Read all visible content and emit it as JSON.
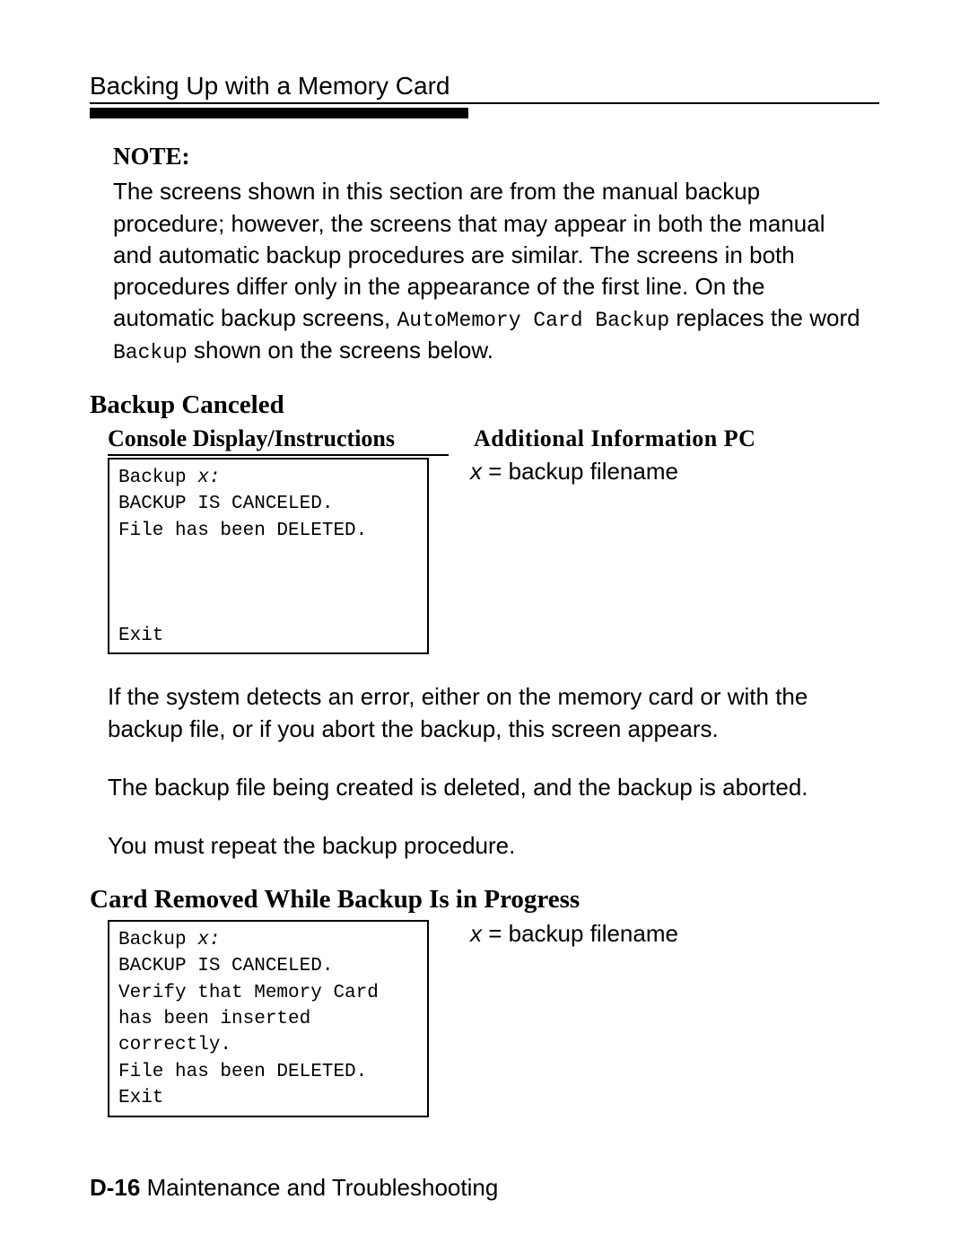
{
  "header": {
    "title": "Backing Up with a Memory Card"
  },
  "note": {
    "label": "NOTE:",
    "body_pre": "The screens shown in this section are from the manual backup procedure; however, the screens that may appear in both the manual and automatic backup procedures are similar. The screens in both procedures differ only in the appearance of the first line. On the automatic backup screens, ",
    "mono1": "AutoMemory Card Backup",
    "body_mid": " replaces the word ",
    "mono2": "Backup",
    "body_post": " shown on the screens below."
  },
  "section1": {
    "heading": "Backup Canceled",
    "col_left": "Console Display/Instructions",
    "col_right": "Additional Information PC",
    "console": {
      "l1a": "Backup ",
      "l1b": "x:",
      "l2": "BACKUP IS CANCELED.",
      "l3": "File has been DELETED.",
      "exit": "Exit"
    },
    "side_pre": "x",
    "side_post": " = backup filename",
    "para1": "If the system detects an error, either on the memory card or with the backup file, or if you abort the backup, this screen appears.",
    "para2": "The backup file being created is deleted, and the backup is aborted.",
    "para3": "You must repeat the backup procedure."
  },
  "section2": {
    "heading": "Card Removed While Backup Is in Progress",
    "console": {
      "l1a": "Backup ",
      "l1b": "x:",
      "l2": "BACKUP IS CANCELED.",
      "l3": "Verify that Memory Card",
      "l4": "has been inserted",
      "l5": "correctly.",
      "l6": "File has been DELETED.",
      "exit": "Exit"
    },
    "side_pre": "x",
    "side_post": " = backup filename"
  },
  "footer": {
    "page": "D-16",
    "label": " Maintenance and Troubleshooting"
  }
}
